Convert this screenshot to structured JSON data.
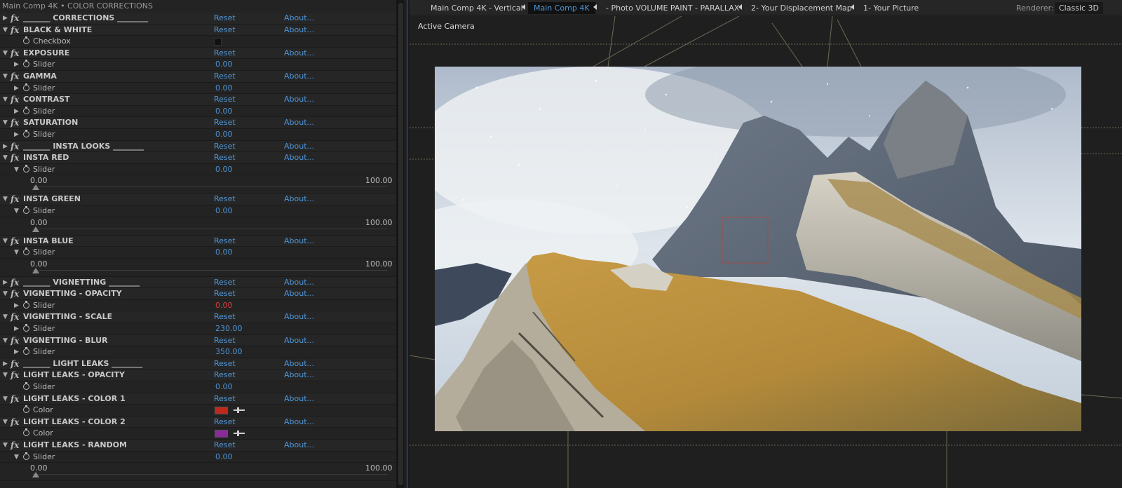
{
  "effect_panel": {
    "title": "Main Comp 4K • COLOR CORRECTIONS",
    "reset_label": "Reset",
    "about_label": "About...",
    "rows": [
      {
        "kind": "effect",
        "twirl": "▶",
        "name": "_______ CORRECTIONS ________"
      },
      {
        "kind": "effect",
        "twirl": "▼",
        "name": "BLACK & WHITE"
      },
      {
        "kind": "checkbox",
        "name": "Checkbox",
        "checked": false
      },
      {
        "kind": "effect",
        "twirl": "▼",
        "name": "EXPOSURE"
      },
      {
        "kind": "slider",
        "twirl": "▶",
        "name": "Slider",
        "value": "0.00"
      },
      {
        "kind": "effect",
        "twirl": "▼",
        "name": "GAMMA"
      },
      {
        "kind": "slider",
        "twirl": "▶",
        "name": "Slider",
        "value": "0.00"
      },
      {
        "kind": "effect",
        "twirl": "▼",
        "name": "CONTRAST"
      },
      {
        "kind": "slider",
        "twirl": "▶",
        "name": "Slider",
        "value": "0.00"
      },
      {
        "kind": "effect",
        "twirl": "▼",
        "name": "SATURATION"
      },
      {
        "kind": "slider",
        "twirl": "▶",
        "name": "Slider",
        "value": "0.00"
      },
      {
        "kind": "effect",
        "twirl": "▶",
        "name": "_______ INSTA LOOKS ________"
      },
      {
        "kind": "effect",
        "twirl": "▼",
        "name": "INSTA RED"
      },
      {
        "kind": "slider",
        "twirl": "▼",
        "name": "Slider",
        "value": "0.00"
      },
      {
        "kind": "range",
        "min": "0.00",
        "max": "100.00",
        "level": 0
      },
      {
        "kind": "effect",
        "twirl": "▼",
        "name": "INSTA GREEN"
      },
      {
        "kind": "slider",
        "twirl": "▼",
        "name": "Slider",
        "value": "0.00"
      },
      {
        "kind": "range",
        "min": "0.00",
        "max": "100.00",
        "level": 0
      },
      {
        "kind": "effect",
        "twirl": "▼",
        "name": "INSTA BLUE"
      },
      {
        "kind": "slider",
        "twirl": "▼",
        "name": "Slider",
        "value": "0.00"
      },
      {
        "kind": "range",
        "min": "0.00",
        "max": "100.00",
        "level": 0
      },
      {
        "kind": "effect",
        "twirl": "▶",
        "name": "_______ VIGNETTING ________"
      },
      {
        "kind": "effect",
        "twirl": "▼",
        "name": "VIGNETTING - OPACITY"
      },
      {
        "kind": "slider",
        "twirl": "▶",
        "name": "Slider",
        "value": "0.00",
        "value_color": "red"
      },
      {
        "kind": "effect",
        "twirl": "▼",
        "name": "VIGNETTING - SCALE"
      },
      {
        "kind": "slider",
        "twirl": "▶",
        "name": "Slider",
        "value": "230.00"
      },
      {
        "kind": "effect",
        "twirl": "▼",
        "name": "VIGNETTING - BLUR"
      },
      {
        "kind": "slider",
        "twirl": "▶",
        "name": "Slider",
        "value": "350.00"
      },
      {
        "kind": "effect",
        "twirl": "▶",
        "name": "_______ LIGHT LEAKS ________"
      },
      {
        "kind": "effect",
        "twirl": "▼",
        "name": "LIGHT LEAKS - OPACITY"
      },
      {
        "kind": "slider",
        "twirl": "",
        "name": "Slider",
        "value": "0.00"
      },
      {
        "kind": "effect",
        "twirl": "▼",
        "name": "LIGHT LEAKS - COLOR 1"
      },
      {
        "kind": "color",
        "name": "Color",
        "color": "#c0281c"
      },
      {
        "kind": "effect",
        "twirl": "▼",
        "name": "LIGHT LEAKS - COLOR 2"
      },
      {
        "kind": "color",
        "name": "Color",
        "color": "#8a2a9a"
      },
      {
        "kind": "effect",
        "twirl": "▼",
        "name": "LIGHT LEAKS - RANDOM"
      },
      {
        "kind": "slider",
        "twirl": "▼",
        "name": "Slider",
        "value": "0.00"
      },
      {
        "kind": "range",
        "min": "0.00",
        "max": "100.00",
        "level": 0
      }
    ]
  },
  "viewer": {
    "tabs": [
      {
        "label": "Main Comp 4K - Vertical",
        "active": false
      },
      {
        "label": "Main Comp 4K",
        "active": true
      },
      {
        "label": "- Photo VOLUME PAINT - PARALLAX",
        "active": false
      },
      {
        "label": "2- Your Displacement Map",
        "active": false
      },
      {
        "label": "1- Your Picture",
        "active": false
      }
    ],
    "renderer_label": "Renderer:",
    "renderer_value": "Classic 3D",
    "camera_label": "Active Camera"
  },
  "colors": {
    "accent": "#4e95d6",
    "panel_bg": "#232323",
    "value_red": "#e03a3a"
  }
}
